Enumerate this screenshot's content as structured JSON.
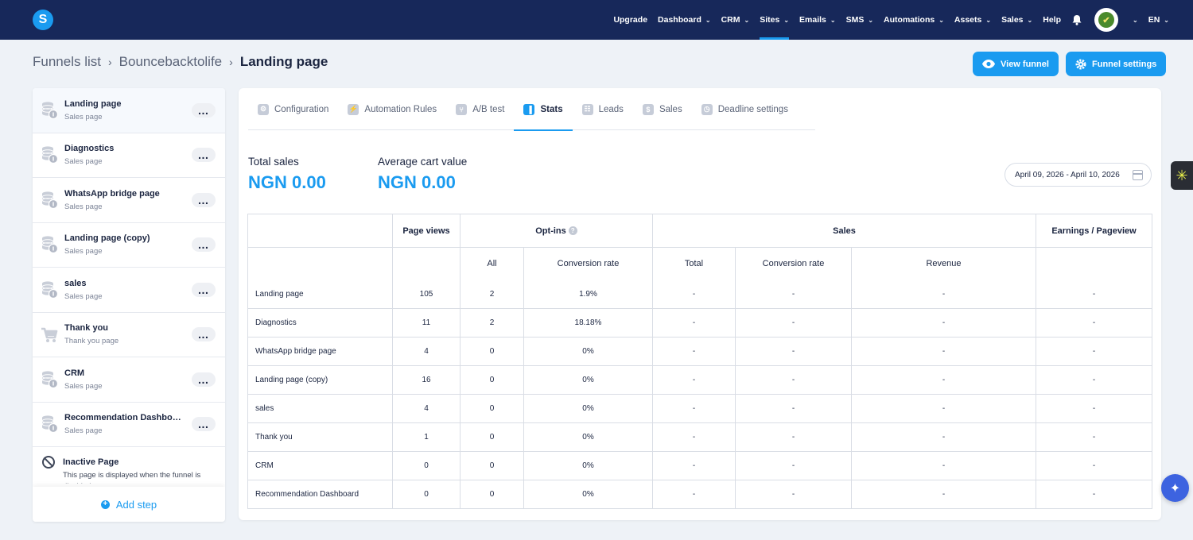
{
  "nav": {
    "logo": "S",
    "items": [
      {
        "label": "Upgrade",
        "dropdown": false,
        "active": false
      },
      {
        "label": "Dashboard",
        "dropdown": true,
        "active": false
      },
      {
        "label": "CRM",
        "dropdown": true,
        "active": false
      },
      {
        "label": "Sites",
        "dropdown": true,
        "active": true
      },
      {
        "label": "Emails",
        "dropdown": true,
        "active": false
      },
      {
        "label": "SMS",
        "dropdown": true,
        "active": false
      },
      {
        "label": "Automations",
        "dropdown": true,
        "active": false
      },
      {
        "label": "Assets",
        "dropdown": true,
        "active": false
      },
      {
        "label": "Sales",
        "dropdown": true,
        "active": false
      },
      {
        "label": "Help",
        "dropdown": false,
        "active": false
      }
    ],
    "language": "EN"
  },
  "breadcrumb": [
    "Funnels list",
    "Bouncebacktolife",
    "Landing page"
  ],
  "header": {
    "view_funnel": "View funnel",
    "funnel_settings": "Funnel settings"
  },
  "sidebar": {
    "steps": [
      {
        "title": "Landing page",
        "subtitle": "Sales page",
        "icon": "coins-icon",
        "selected": true
      },
      {
        "title": "Diagnostics",
        "subtitle": "Sales page",
        "icon": "coins-icon",
        "selected": false
      },
      {
        "title": "WhatsApp bridge page",
        "subtitle": "Sales page",
        "icon": "coins-icon",
        "selected": false
      },
      {
        "title": "Landing page (copy)",
        "subtitle": "Sales page",
        "icon": "coins-icon",
        "selected": false
      },
      {
        "title": "sales",
        "subtitle": "Sales page",
        "icon": "coins-icon",
        "selected": false
      },
      {
        "title": "Thank you",
        "subtitle": "Thank you page",
        "icon": "cart-icon",
        "selected": false
      },
      {
        "title": "CRM",
        "subtitle": "Sales page",
        "icon": "coins-icon",
        "selected": false
      },
      {
        "title": "Recommendation Dashboard",
        "subtitle": "Sales page",
        "icon": "coins-icon",
        "selected": false
      }
    ],
    "inactive": {
      "title": "Inactive Page",
      "description": "This page is displayed when the funnel is disabled"
    },
    "add_step": "Add step"
  },
  "tabs": [
    {
      "label": "Configuration",
      "icon": "configuration-icon",
      "active": false
    },
    {
      "label": "Automation Rules",
      "icon": "automation-icon",
      "active": false
    },
    {
      "label": "A/B test",
      "icon": "ab-test-icon",
      "active": false
    },
    {
      "label": "Stats",
      "icon": "stats-icon",
      "active": true
    },
    {
      "label": "Leads",
      "icon": "leads-icon",
      "active": false
    },
    {
      "label": "Sales",
      "icon": "dollar-icon",
      "active": false
    },
    {
      "label": "Deadline settings",
      "icon": "clock-icon",
      "active": false
    }
  ],
  "metrics": {
    "total_sales_label": "Total sales",
    "total_sales_value": "NGN 0.00",
    "avg_cart_label": "Average cart value",
    "avg_cart_value": "NGN 0.00"
  },
  "date_range": "April 09, 2026 - April 10, 2026",
  "table": {
    "headers": {
      "page_views": "Page views",
      "opt_ins": "Opt-ins",
      "sales": "Sales",
      "earnings": "Earnings / Pageview"
    },
    "subheaders": {
      "all": "All",
      "optin_conv": "Conversion rate",
      "total": "Total",
      "sales_conv": "Conversion rate",
      "revenue": "Revenue"
    },
    "rows": [
      {
        "name": "Landing page",
        "views": "105",
        "optins": "2",
        "optin_rate": "1.9%",
        "total": "-",
        "sales_rate": "-",
        "revenue": "-",
        "earnings": "-"
      },
      {
        "name": "Diagnostics",
        "views": "11",
        "optins": "2",
        "optin_rate": "18.18%",
        "total": "-",
        "sales_rate": "-",
        "revenue": "-",
        "earnings": "-"
      },
      {
        "name": "WhatsApp bridge page",
        "views": "4",
        "optins": "0",
        "optin_rate": "0%",
        "total": "-",
        "sales_rate": "-",
        "revenue": "-",
        "earnings": "-"
      },
      {
        "name": "Landing page (copy)",
        "views": "16",
        "optins": "0",
        "optin_rate": "0%",
        "total": "-",
        "sales_rate": "-",
        "revenue": "-",
        "earnings": "-"
      },
      {
        "name": "sales",
        "views": "4",
        "optins": "0",
        "optin_rate": "0%",
        "total": "-",
        "sales_rate": "-",
        "revenue": "-",
        "earnings": "-"
      },
      {
        "name": "Thank you",
        "views": "1",
        "optins": "0",
        "optin_rate": "0%",
        "total": "-",
        "sales_rate": "-",
        "revenue": "-",
        "earnings": "-"
      },
      {
        "name": "CRM",
        "views": "0",
        "optins": "0",
        "optin_rate": "0%",
        "total": "-",
        "sales_rate": "-",
        "revenue": "-",
        "earnings": "-"
      },
      {
        "name": "Recommendation Dashboard",
        "views": "0",
        "optins": "0",
        "optin_rate": "0%",
        "total": "-",
        "sales_rate": "-",
        "revenue": "-",
        "earnings": "-"
      }
    ]
  },
  "colors": {
    "nav_bg": "#17285a",
    "accent": "#1a9bf0"
  }
}
